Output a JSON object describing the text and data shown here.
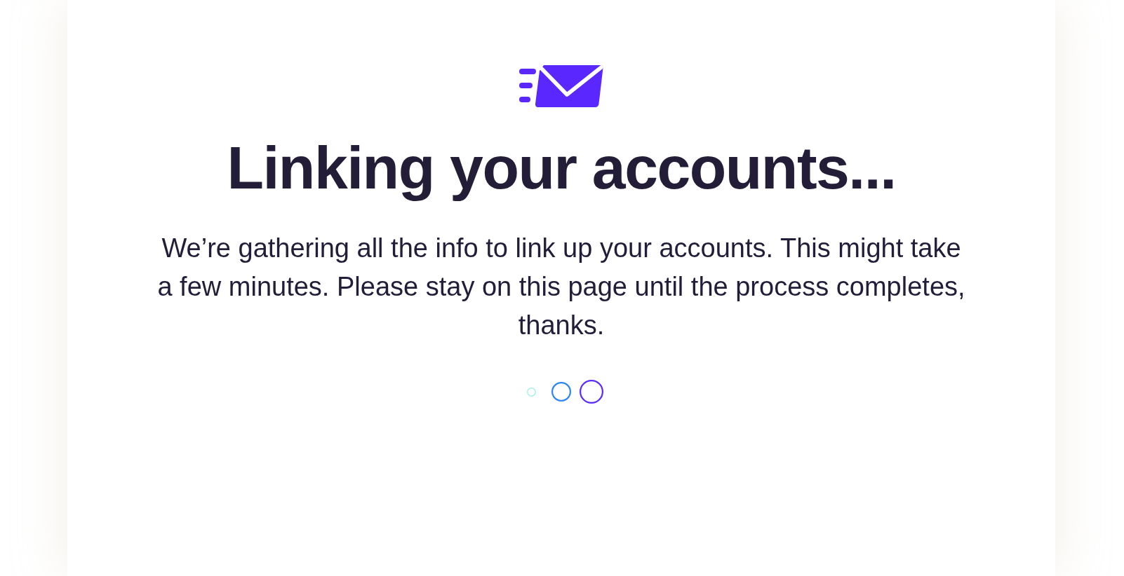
{
  "heading": "Linking your accounts...",
  "message": "We’re gathering all the info to link up your accounts. This might take a few minutes. Please stay on this page until the process completes, thanks.",
  "loader": {
    "rings": [
      {
        "color": "#a6f2e8"
      },
      {
        "color": "#2d86f4"
      },
      {
        "color": "#5b2bff"
      }
    ]
  }
}
